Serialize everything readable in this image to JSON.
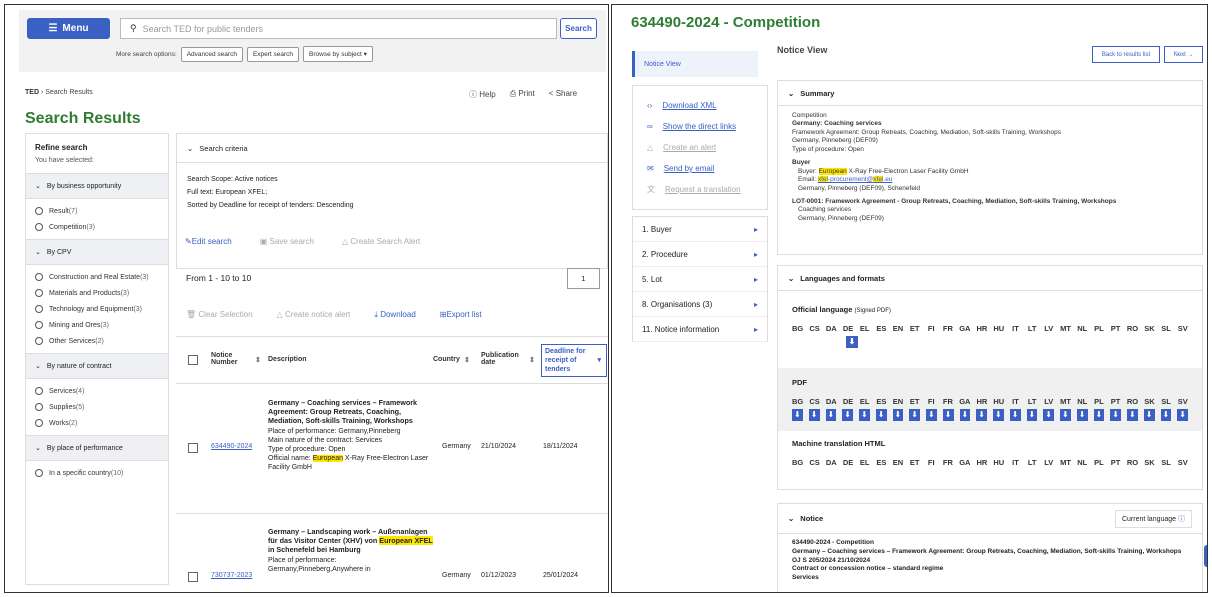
{
  "left": {
    "menu_label": "Menu",
    "search_placeholder": "Search TED for public tenders",
    "search_button": "Search",
    "more_label": "More search options:",
    "adv": "Advanced search",
    "expert": "Expert search",
    "browse": "Browse by subject",
    "crumb_home": "TED",
    "crumb_current": "Search Results",
    "help": "Help",
    "print": "Print",
    "share": "Share",
    "title": "Search Results",
    "refine_title": "Refine search",
    "refine_sub": "You have selected:",
    "groups": [
      {
        "label": "By business opportunity",
        "items": [
          [
            "Result",
            "(7)"
          ],
          [
            "Competition",
            "(3)"
          ]
        ]
      },
      {
        "label": "By CPV",
        "items": [
          [
            "Construction and Real Estate",
            "(3)"
          ],
          [
            "Materials and Products",
            "(3)"
          ],
          [
            "Technology and Equipment",
            "(3)"
          ],
          [
            "Mining and Ores",
            "(3)"
          ],
          [
            "Other Services",
            "(2)"
          ]
        ]
      },
      {
        "label": "By nature of contract",
        "items": [
          [
            "Services",
            "(4)"
          ],
          [
            "Supplies",
            "(5)"
          ],
          [
            "Works",
            "(2)"
          ]
        ]
      },
      {
        "label": "By place of performance",
        "items": [
          [
            "In a specific country",
            "(10)"
          ]
        ]
      }
    ],
    "crit_title": "Search criteria",
    "scope": "Search Scope: Active notices",
    "fulltext": "Full text: European XFEL;",
    "sorted": "Sorted by Deadline for receipt of tenders: Descending",
    "edit": "Edit search",
    "save": "Save search",
    "create_alert": "Create Search Alert",
    "range": "From 1 - 10 to 10",
    "page": "1",
    "clear": "Clear Selection",
    "notice_alert": "Create notice alert",
    "download": "Download",
    "export": "Export list",
    "th_num": "Notice Number",
    "th_desc": "Description",
    "th_country": "Country",
    "th_pub": "Publication date",
    "th_deadline": "Deadline for receipt of tenders",
    "rows": [
      {
        "num": "634490-2024",
        "title": "Germany – Coaching services – Framework Agreement: Group Retreats, Coaching, Mediation, Soft-skills Training, Workshops",
        "place": "Place of performance: Germany,Pinneberg",
        "nature": "Main nature of the contract: Services",
        "proc": "Type of procedure: Open",
        "off_pre": "Official name: ",
        "off_hl": "European",
        "off_post": " X-Ray Free-Electron Laser Facility GmbH",
        "country": "Germany",
        "pub": "21/10/2024",
        "deadline": "18/11/2024"
      },
      {
        "num": "730737-2023",
        "title_pre": "Germany – Landscaping work – Außenanlagen für das Visitor Center (XHV) von ",
        "title_hl": "European XFEL",
        "title_post": " in Schenefeld bei Hamburg",
        "place": "Place of performance: Germany,Pinneberg,Anywhere in",
        "country": "Germany",
        "pub": "01/12/2023",
        "deadline": "25/01/2024"
      }
    ]
  },
  "right": {
    "title": "634490-2024 - Competition",
    "notice_view_tab": "Notice View",
    "notice_view": "Notice View",
    "back": "Back to results list",
    "next": "Next",
    "links": [
      "Download XML",
      "Show the direct links",
      "Create an alert",
      "Send by email",
      "Request a translation"
    ],
    "nav": [
      "1. Buyer",
      "2. Procedure",
      "5. Lot",
      "8. Organisations (3)",
      "11. Notice information"
    ],
    "summary_title": "Summary",
    "s1": "Competition",
    "s2": "Germany: Coaching services",
    "s3": "Framework Agreement: Group Retreats, Coaching, Mediation, Soft-skills Training, Workshops",
    "s4": "Germany, Pinneberg (DEF09)",
    "s5": "Type of procedure: Open",
    "buyer_h": "Buyer",
    "buyer_pre": "Buyer: ",
    "buyer_hl": "European",
    "buyer_post": " X-Ray Free-Electron Laser Facility GmbH",
    "email_pre": "Email: ",
    "email_a": "xfel",
    "email_b": "-procurement@",
    "email_c": "xfel",
    "email_d": ".eu",
    "buyer_loc": "Germany, Pinneberg (DEF09), Schenefeld",
    "lot": "LOT-0001: Framework Agreement - Group Retreats, Coaching, Mediation, Soft-skills Training, Workshops",
    "lot1": "Coaching services",
    "lot2": "Germany, Pinneberg (DEF09)",
    "lang_title": "Languages and formats",
    "official": "Official language",
    "signed": "(Signed PDF)",
    "pdf": "PDF",
    "mt": "Machine translation HTML",
    "codes": [
      "BG",
      "CS",
      "DA",
      "DE",
      "EL",
      "ES",
      "EN",
      "ET",
      "FI",
      "FR",
      "GA",
      "HR",
      "HU",
      "IT",
      "LT",
      "LV",
      "MT",
      "NL",
      "PL",
      "PT",
      "RO",
      "SK",
      "SL",
      "SV"
    ],
    "notice_title": "Notice",
    "current_lang": "Current language",
    "n1": "634490-2024 - Competition",
    "n2": "Germany – Coaching services – Framework Agreement: Group Retreats, Coaching, Mediation, Soft-skills Training, Workshops",
    "n3": "OJ S 205/2024 21/10/2024",
    "n4": "Contract or concession notice – standard regime",
    "n5": "Services"
  }
}
